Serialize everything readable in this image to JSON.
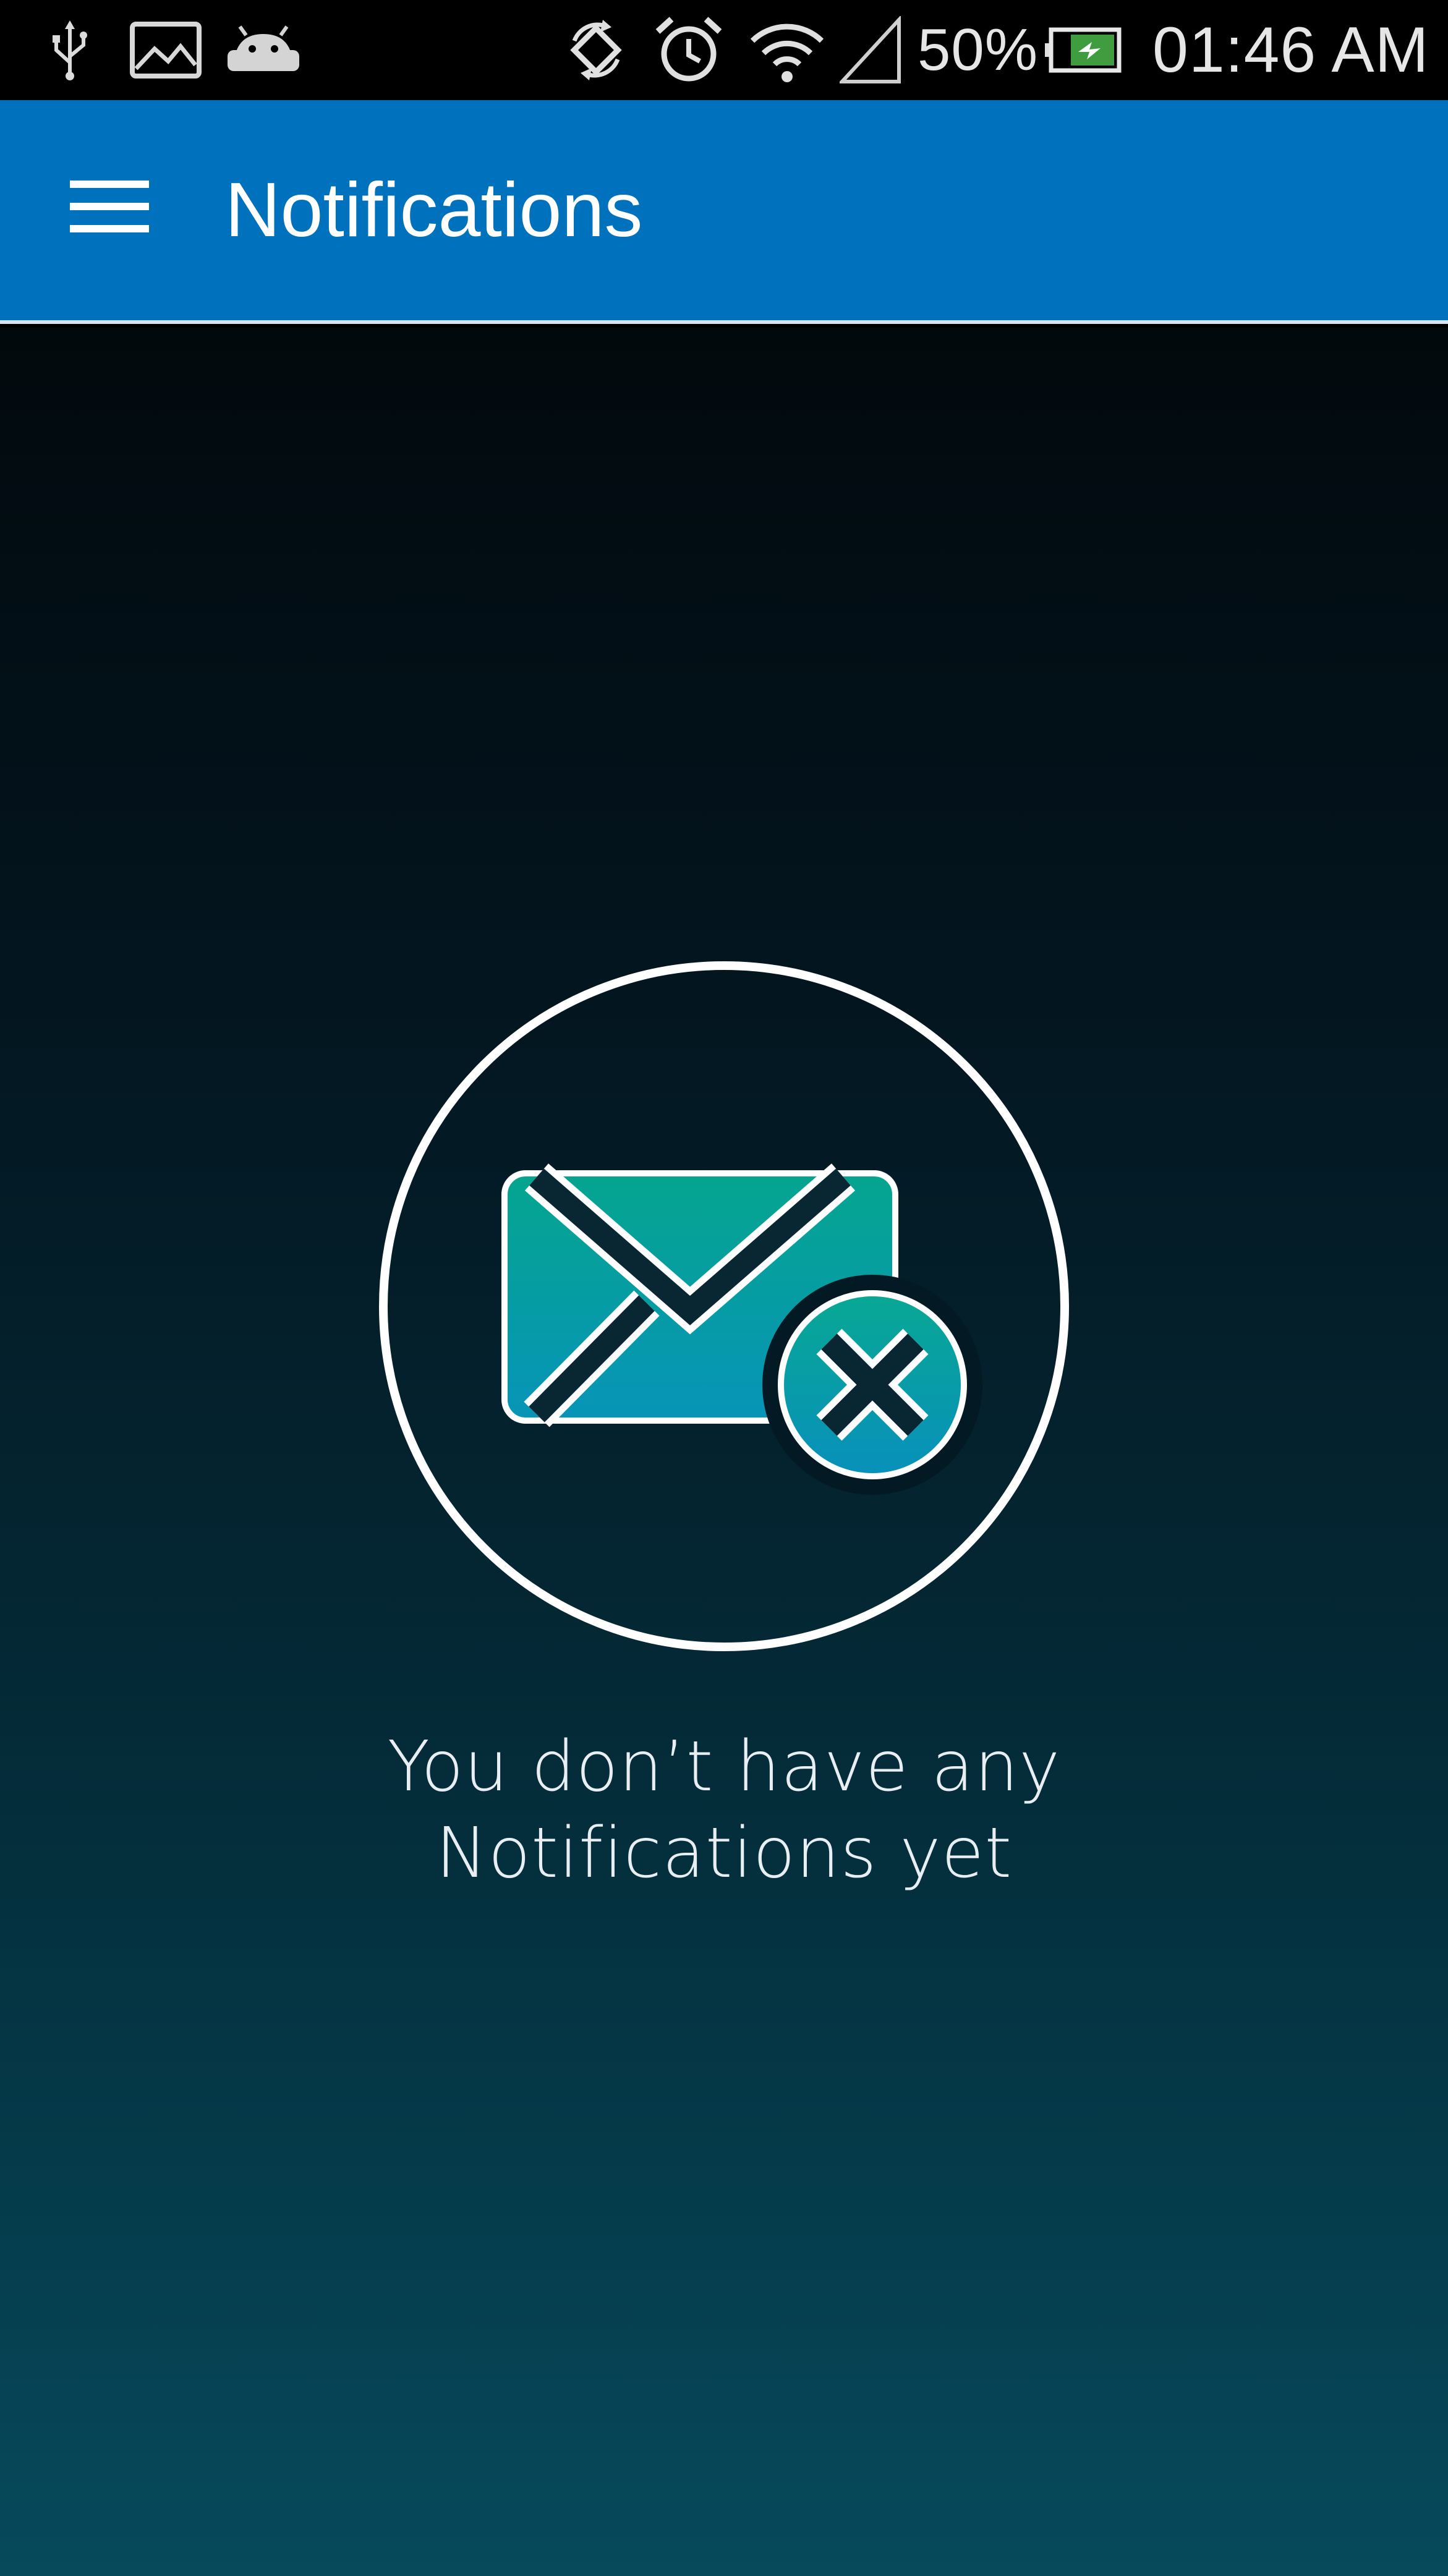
{
  "status_bar": {
    "battery_percent": "50%",
    "time": "01:46 AM",
    "icons": [
      "usb-icon",
      "image-icon",
      "android-icon",
      "sync-icon",
      "alarm-icon",
      "wifi-icon",
      "signal-icon",
      "battery-charging-icon"
    ]
  },
  "app_bar": {
    "title": "Notifications",
    "menu_icon": "hamburger-menu-icon",
    "color": "#0071bc"
  },
  "empty_state": {
    "icon": "mail-error-icon",
    "line1": "You don’t have any",
    "line2": "Notifications yet"
  }
}
